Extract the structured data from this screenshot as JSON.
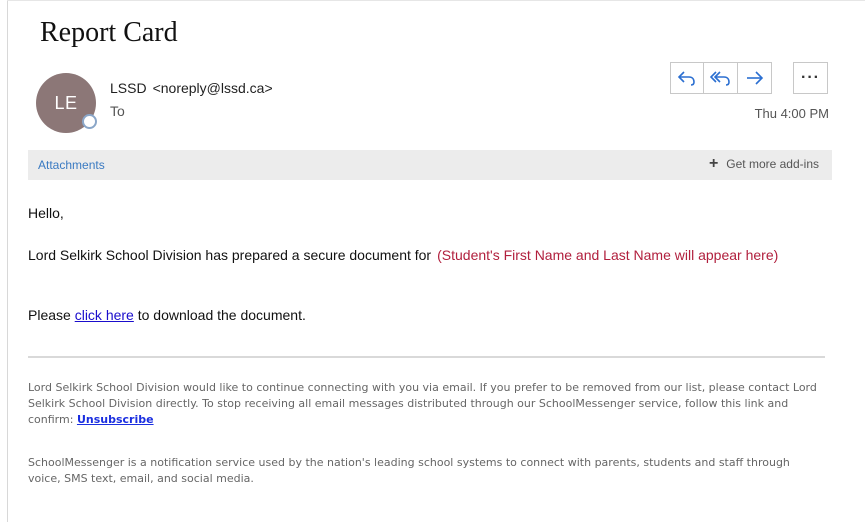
{
  "message": {
    "subject": "Report Card",
    "avatar_initials": "LE",
    "sender_name": "LSSD",
    "sender_address": "<noreply@lssd.ca>",
    "to_label": "To",
    "timestamp": "Thu 4:00 PM"
  },
  "actions": {
    "reply_icon": "reply-icon",
    "reply_all_icon": "reply-all-icon",
    "forward_icon": "forward-icon",
    "more_label": "···"
  },
  "attachments_bar": {
    "label": "Attachments",
    "addins_label": "Get more add-ins"
  },
  "body": {
    "greeting": "Hello,",
    "intro": "Lord Selkirk School Division has prepared a secure document for",
    "placeholder": "(Student's First Name and Last Name will appear here)",
    "download_before": "Please",
    "download_link": "click here",
    "download_after": "to download the document."
  },
  "footer": {
    "paragraph1": "Lord Selkirk School Division would like to continue connecting with you via email. If you prefer to be removed from our list, please contact Lord Selkirk School Division directly. To stop receiving all email messages distributed through our SchoolMessenger service, follow this link and confirm:",
    "unsubscribe": "Unsubscribe",
    "paragraph2": "SchoolMessenger is a notification service used by the nation's leading school systems to connect with parents, students and staff through voice, SMS text, email, and social media."
  },
  "colors": {
    "avatar": "#8c7777",
    "placeholder_text": "#b11f3d",
    "link": "#1a0dcc",
    "action_icon": "#2b6fd1"
  }
}
